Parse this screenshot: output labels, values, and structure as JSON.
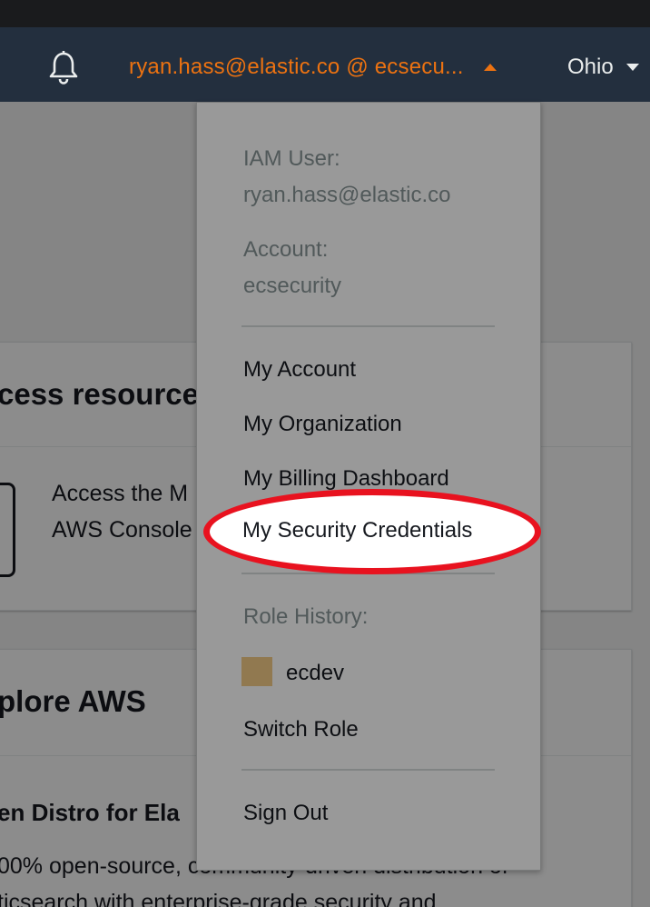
{
  "nav": {
    "user_label": "ryan.hass@elastic.co @ ecsecu...",
    "region_label": "Ohio",
    "icons": {
      "notifications": "bell-icon",
      "user_caret": "caret-up-icon",
      "region_caret": "caret-down-icon"
    },
    "colors": {
      "nav_bg": "#232f3e",
      "accent": "#ec7211"
    }
  },
  "background": {
    "card1": {
      "title": "cess resources",
      "body_line1": "Access the M",
      "body_line2": "AWS Console"
    },
    "card2": {
      "title": "plore AWS",
      "subtitle": "en Distro for Ela",
      "body_line1": "00% open-source, community-driven distribution of",
      "body_line2": "ticsearch with enterprise-grade security and"
    }
  },
  "dropdown": {
    "iam_user_label": "IAM User:",
    "iam_user_value": "ryan.hass@elastic.co",
    "account_label": "Account:",
    "account_value": "ecsecurity",
    "items": {
      "my_account": "My Account",
      "my_organization": "My Organization",
      "my_billing_dashboard": "My Billing Dashboard",
      "my_security_credentials": "My Security Credentials"
    },
    "role_history_label": "Role History:",
    "role_name": "ecdev",
    "role_color": "#f2c986",
    "switch_role": "Switch Role",
    "sign_out": "Sign Out"
  },
  "annotation": {
    "highlight_color": "#e8121f"
  }
}
